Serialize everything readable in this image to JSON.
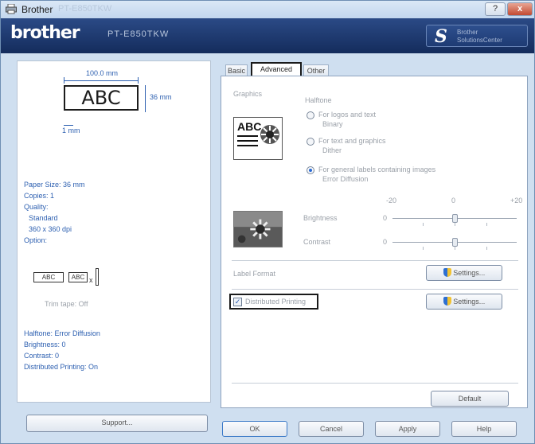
{
  "window": {
    "title": "Brother",
    "model_ghost": "PT-E850TKW",
    "help_label": "?",
    "close_label": "x"
  },
  "banner": {
    "logo": "brother",
    "model": "PT-E850TKW",
    "solutions_line1": "Brother",
    "solutions_line2": "SolutionsCenter"
  },
  "preview": {
    "width_dim": "100.0 mm",
    "height_dim": "36 mm",
    "margin_dim": "1 mm",
    "sample_text": "ABC",
    "info": [
      "Paper Size: 36 mm",
      "Copies: 1",
      "Quality:",
      "Standard",
      "360 x 360 dpi",
      "Option:"
    ],
    "tape_samples": [
      "ABC",
      "ABC"
    ],
    "trim_text": "Trim tape: Off",
    "summary": [
      "Halftone: Error Diffusion",
      "Brightness: 0",
      "Contrast: 0",
      "Distributed Printing: On"
    ]
  },
  "support_label": "Support...",
  "tabs": [
    "Basic",
    "Advanced",
    "Other"
  ],
  "advanced": {
    "graphics_label": "Graphics",
    "halftone_label": "Halftone",
    "options": [
      {
        "line1": "For logos and text",
        "line2": "Binary",
        "selected": false
      },
      {
        "line1": "For text and graphics",
        "line2": "Dither",
        "selected": false
      },
      {
        "line1": "For general labels containing images",
        "line2": "Error Diffusion",
        "selected": true
      }
    ],
    "scale_min": "-20",
    "scale_mid": "0",
    "scale_max": "+20",
    "brightness_label": "Brightness",
    "brightness_value": "0",
    "brightness_level": 0,
    "contrast_label": "Contrast",
    "contrast_value": "0",
    "contrast_level": 0,
    "label_format_label": "Label Format",
    "settings_label": "Settings...",
    "distributed_label": "Distributed Printing",
    "distributed_checked": true,
    "default_label": "Default"
  },
  "footer": {
    "ok": "OK",
    "cancel": "Cancel",
    "apply": "Apply",
    "help": "Help"
  }
}
